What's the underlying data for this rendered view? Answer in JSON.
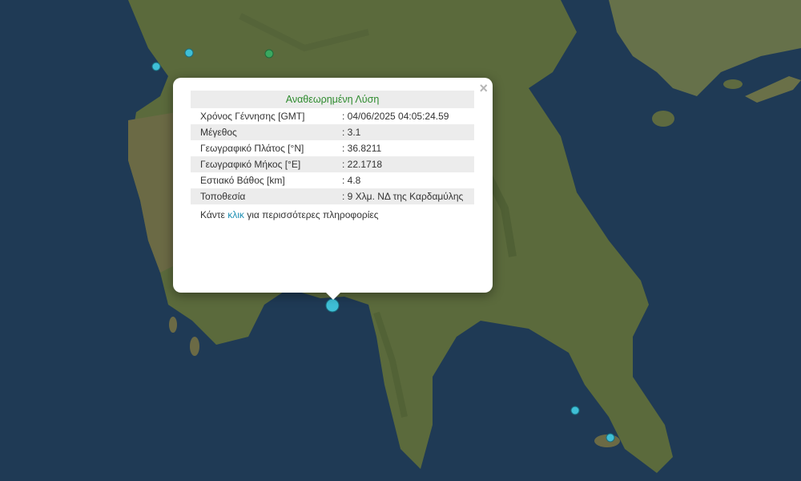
{
  "popup": {
    "title": "Αναθεωρημένη Λύση",
    "close_glyph": "×",
    "rows": [
      {
        "label": "Χρόνος Γέννησης [GMT]",
        "value": ": 04/06/2025 04:05:24.59"
      },
      {
        "label": "Μέγεθος",
        "value": ": 3.1"
      },
      {
        "label": "Γεωγραφικό Πλάτος [°N]",
        "value": ": 36.8211"
      },
      {
        "label": "Γεωγραφικό Μήκος [°E]",
        "value": ": 22.1718"
      },
      {
        "label": "Εστιακό Βάθος [km]",
        "value": ": 4.8"
      },
      {
        "label": "Τοποθεσία",
        "value": ": 9 Χλμ. ΝΔ της Καρδαμύλης"
      }
    ],
    "footer_before": "Κάντε ",
    "footer_link": "κλικ",
    "footer_after": " για περισσότερες πληροφορίες"
  },
  "colors": {
    "sea": "#1f3a55",
    "land": "#5a6b3a",
    "marker_cyan": "#3fbfd6",
    "marker_green": "#3aa860",
    "title_green": "#2e8b2e",
    "link": "#1d8fb3"
  },
  "markers": [
    {
      "name": "selected-earthquake-marker",
      "color": "cyan",
      "selected": true
    },
    {
      "name": "earthquake-marker",
      "color": "cyan"
    },
    {
      "name": "earthquake-marker",
      "color": "cyan"
    },
    {
      "name": "earthquake-marker",
      "color": "green"
    },
    {
      "name": "earthquake-marker",
      "color": "cyan"
    },
    {
      "name": "earthquake-marker",
      "color": "cyan"
    }
  ]
}
